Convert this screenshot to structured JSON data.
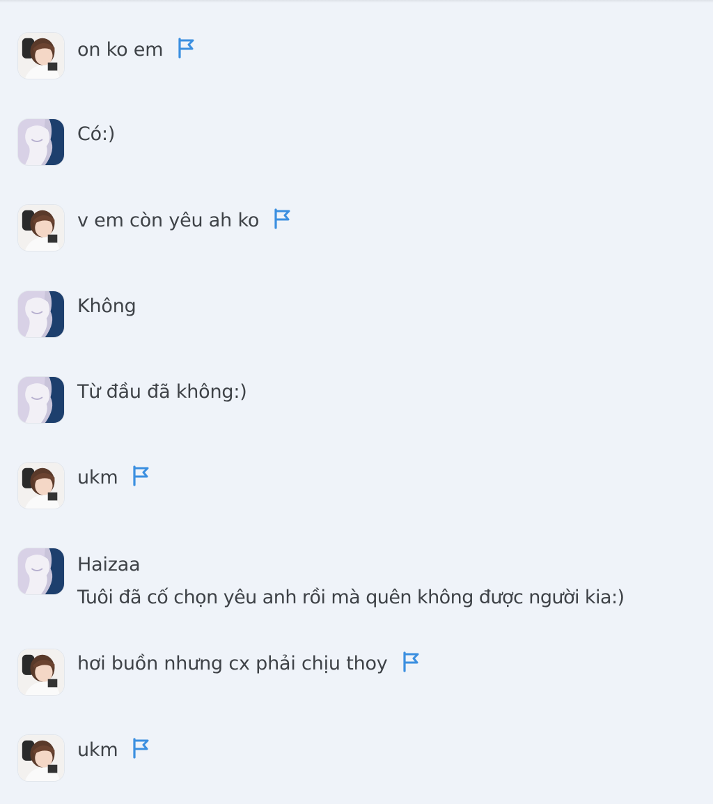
{
  "messages": [
    {
      "sender": "boy",
      "lines": [
        "on ko em"
      ],
      "flag": true
    },
    {
      "sender": "girl",
      "lines": [
        "Có:)"
      ],
      "flag": false
    },
    {
      "sender": "boy",
      "lines": [
        "v em còn yêu ah ko"
      ],
      "flag": true
    },
    {
      "sender": "girl",
      "lines": [
        "Không"
      ],
      "flag": false
    },
    {
      "sender": "girl",
      "lines": [
        "Từ đầu đã không:)"
      ],
      "flag": false
    },
    {
      "sender": "boy",
      "lines": [
        "ukm"
      ],
      "flag": true
    },
    {
      "sender": "girl",
      "lines": [
        "Haizaa",
        "Tuôi đã cố chọn yêu anh rồi mà quên không được người kia:)"
      ],
      "flag": false
    },
    {
      "sender": "boy",
      "lines": [
        "hơi buồn nhưng cx phải chịu thoy"
      ],
      "flag": true
    },
    {
      "sender": "boy",
      "lines": [
        "ukm"
      ],
      "flag": true
    }
  ],
  "icons": {
    "flag": "flag-icon",
    "avatar_boy": "avatar-photo",
    "avatar_girl": "avatar-anime"
  },
  "colors": {
    "background": "#eff3f9",
    "text": "#3e4247",
    "flag": "#3b8fe0"
  }
}
